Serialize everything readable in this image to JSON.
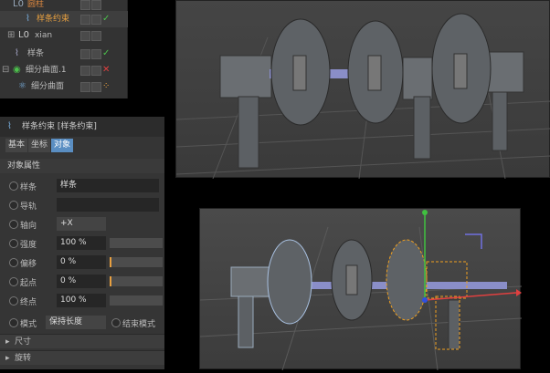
{
  "object_manager": {
    "rows": [
      {
        "label": "圆柱",
        "indent": 1
      },
      {
        "label": "样条约束",
        "indent": 2,
        "highlight": true,
        "status": "✓"
      },
      {
        "label": "xian",
        "indent": 1
      },
      {
        "label": "样条",
        "indent": 1,
        "status": "✓"
      },
      {
        "label": "细分曲面.1",
        "indent": 0,
        "status": "✕"
      },
      {
        "label": "细分曲面",
        "indent": 1
      }
    ]
  },
  "attributes": {
    "title": "样条约束 [样条约束]",
    "tabs": [
      "基本",
      "坐标",
      "对象"
    ],
    "active_tab": "对象",
    "section": "对象属性",
    "spline_label": "样条",
    "spline_value": "样条",
    "rail_label": "导轨",
    "rail_value": "",
    "axis_label": "轴向",
    "axis_value": "+X",
    "strength_label": "强度",
    "strength_value": "100 %",
    "offset_label": "偏移",
    "offset_value": "0 %",
    "start_label": "起点",
    "start_value": "0 %",
    "end_label": "终点",
    "end_value": "100 %",
    "mode_label": "模式",
    "mode_value": "保持长度",
    "end_mode_label": "结束模式",
    "fold1": "尺寸",
    "fold2": "旋转"
  },
  "colors": {
    "panel": "#333333",
    "accent": "#5a8ec2",
    "status_ok": "#4cc04c",
    "status_x": "#e04040",
    "selection": "#f0a020"
  }
}
